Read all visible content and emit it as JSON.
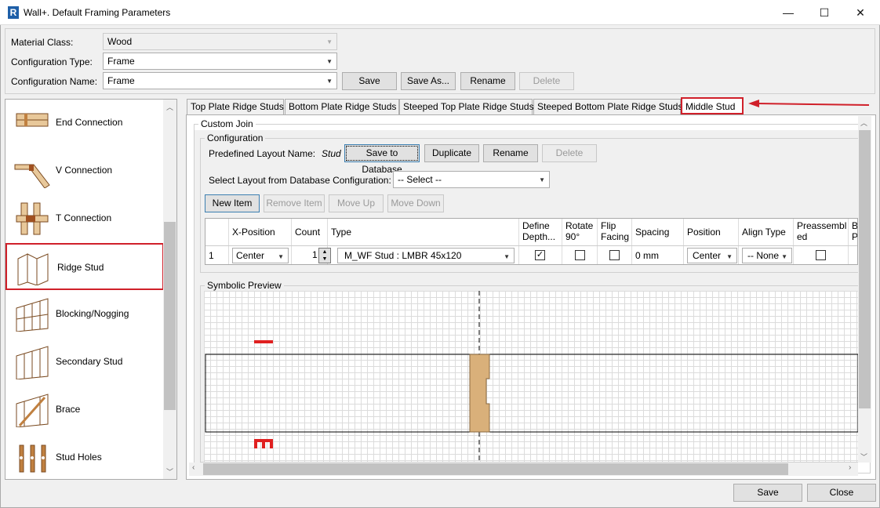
{
  "window": {
    "title": "Wall+. Default Framing Parameters",
    "app_icon": "R",
    "minimize": "—",
    "maximize": "☐",
    "close": "✕"
  },
  "form": {
    "material_class_label": "Material Class:",
    "material_class_value": "Wood",
    "config_type_label": "Configuration Type:",
    "config_type_value": "Frame",
    "config_name_label": "Configuration Name:",
    "config_name_value": "Frame",
    "save": "Save",
    "save_as": "Save As...",
    "rename": "Rename",
    "delete": "Delete"
  },
  "sidebar": {
    "items": [
      {
        "label": "End Connection",
        "icon": "end-connection-icon"
      },
      {
        "label": "V Connection",
        "icon": "v-connection-icon"
      },
      {
        "label": "T Connection",
        "icon": "t-connection-icon"
      },
      {
        "label": "Ridge Stud",
        "icon": "ridge-stud-icon",
        "selected": true
      },
      {
        "label": "Blocking/Nogging",
        "icon": "blocking-nogging-icon"
      },
      {
        "label": "Secondary Stud",
        "icon": "secondary-stud-icon"
      },
      {
        "label": "Brace",
        "icon": "brace-icon"
      },
      {
        "label": "Stud Holes",
        "icon": "stud-holes-icon"
      }
    ]
  },
  "tabs": [
    "Top Plate Ridge Studs",
    "Bottom Plate Ridge Studs",
    "Steeped Top Plate Ridge Studs",
    "Steeped Bottom Plate Ridge Studs",
    "Middle Stud"
  ],
  "selected_tab": "Middle Stud",
  "custom_join": {
    "group_title": "Custom Join",
    "config_title": "Configuration",
    "predefined_label": "Predefined Layout Name:",
    "predefined_value": "Stud",
    "save_db": "Save to Database",
    "duplicate": "Duplicate",
    "rename": "Rename",
    "delete": "Delete",
    "select_layout_label": "Select Layout from Database Configuration:",
    "select_layout_value": "-- Select --",
    "new_item": "New Item",
    "remove_item": "Remove Item",
    "move_up": "Move Up",
    "move_down": "Move Down"
  },
  "grid": {
    "headers": {
      "xpos": "X-Position",
      "count": "Count",
      "type": "Type",
      "define_depth": "Define Depth...",
      "rotate": "Rotate 90°",
      "flip": "Flip Facing",
      "spacing": "Spacing",
      "position": "Position",
      "align": "Align Type",
      "preassembled": "Preassembl ed",
      "extra": "B P"
    },
    "row": {
      "index": "1",
      "xpos": "Center",
      "count": "1",
      "type": "M_WF Stud : LMBR 45x120",
      "define_depth": true,
      "rotate": false,
      "flip": false,
      "spacing": "0 mm",
      "position": "Center",
      "align": "-- None",
      "preassembled": false
    }
  },
  "preview": {
    "title": "Symbolic Preview",
    "stud_color": "#d9b07a",
    "marker_color": "#e02020"
  },
  "footer": {
    "save": "Save",
    "close": "Close"
  },
  "colors": {
    "highlight": "#d0202a"
  }
}
